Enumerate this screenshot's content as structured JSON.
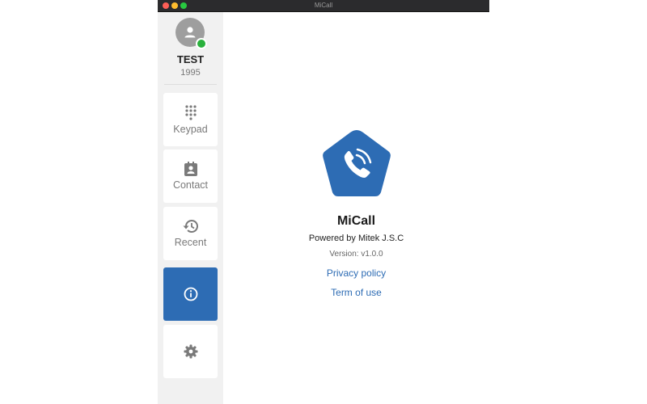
{
  "window": {
    "title": "MiCall"
  },
  "user": {
    "name": "TEST",
    "extension": "1995",
    "status_color": "#2ab13d"
  },
  "nav": {
    "keypad": {
      "label": "Keypad",
      "icon": "dialpad-icon"
    },
    "contact": {
      "label": "Contact",
      "icon": "contact-book-icon"
    },
    "recent": {
      "label": "Recent",
      "icon": "history-icon"
    },
    "info": {
      "label": "",
      "icon": "info-icon",
      "active": true
    },
    "settings": {
      "label": "",
      "icon": "gear-icon"
    }
  },
  "about": {
    "app_name": "MiCall",
    "powered_by": "Powered by Mitek J.S.C",
    "version": "Version: v1.0.0",
    "privacy_link": "Privacy policy",
    "terms_link": "Term of use"
  },
  "colors": {
    "accent": "#2d6cb4",
    "sidebar": "#f1f1f1"
  }
}
